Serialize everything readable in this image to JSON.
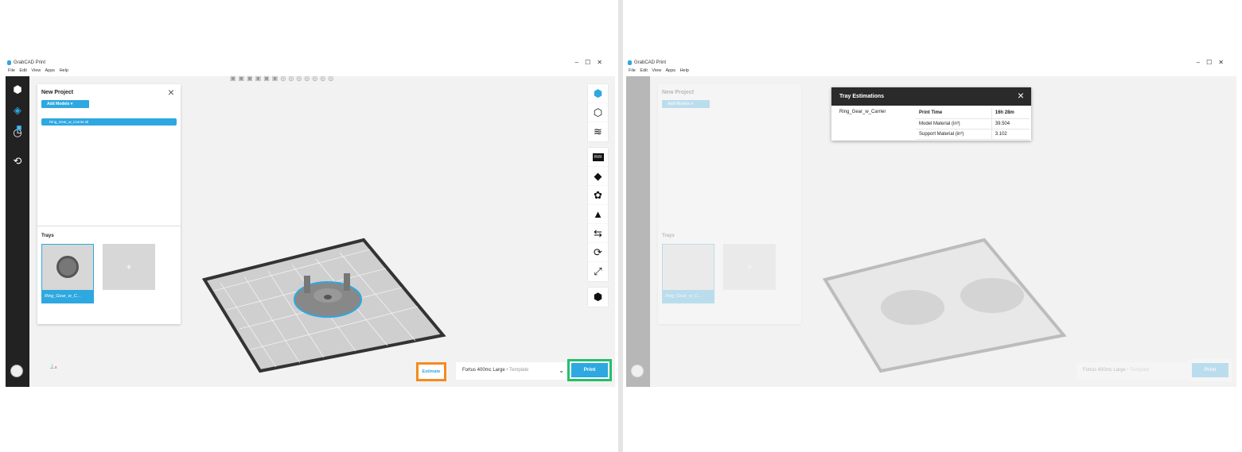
{
  "window": {
    "title": "GrabCAD Print",
    "controls": [
      "–",
      "☐",
      "✕"
    ]
  },
  "menu": [
    "File",
    "Edit",
    "View",
    "Apps",
    "Help"
  ],
  "project": {
    "title": "New Project",
    "add_models": "Add Models",
    "model_file": "Ring_Gear_w_Carrier.stl",
    "trays_label": "Trays",
    "tray_name": "Ring_Gear_w_C...",
    "new_tray": "+"
  },
  "sidebar": {
    "history_badge": "1"
  },
  "tools": {
    "units": "mm"
  },
  "footer": {
    "estimate": "Estimate",
    "printer": "Fortus 400mc Large",
    "printer_sub": " • Template",
    "print": "Print",
    "axis_x": "x"
  },
  "estimations": {
    "title": "Tray Estimations",
    "model": "Ring_Gear_w_Carrier",
    "rows": [
      {
        "label": "Print Time",
        "value": "16h 28m"
      },
      {
        "label": "Model Material (in³)",
        "value": "39.504"
      },
      {
        "label": "Support Material (in³)",
        "value": "3.102"
      }
    ]
  },
  "colors": {
    "accent": "#2ea8e0",
    "estimate_highlight": "#f58a1f",
    "print_highlight": "#22c06a"
  }
}
